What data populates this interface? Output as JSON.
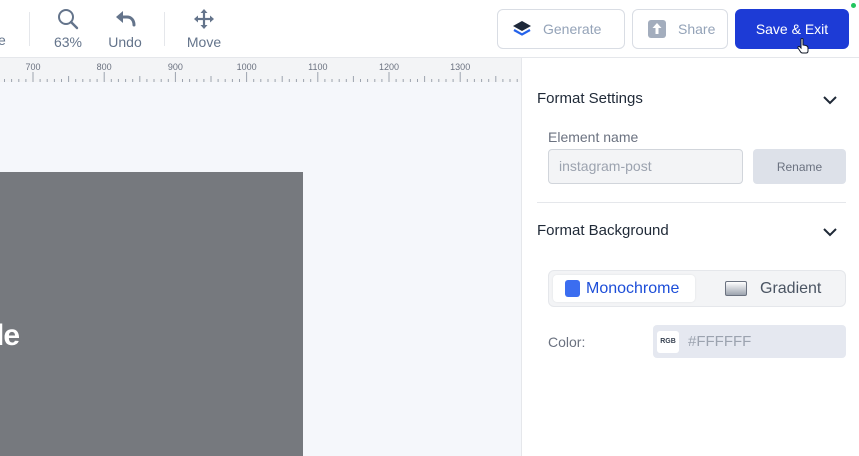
{
  "toolbar": {
    "cut_label": "e",
    "zoom_label": "63%",
    "undo_label": "Undo",
    "move_label": "Move",
    "generate_label": "Generate",
    "share_label": "Share",
    "save_exit_label": "Save & Exit"
  },
  "ruler": {
    "ticks": [
      "700",
      "800",
      "900",
      "1000",
      "1100",
      "1200",
      "1300"
    ]
  },
  "canvas": {
    "artboard_text": "le",
    "artboard_color": "#76797e"
  },
  "panel": {
    "format_settings_title": "Format Settings",
    "element_name_label": "Element name",
    "element_name_value": "instagram-post",
    "rename_label": "Rename",
    "format_background_title": "Format Background",
    "bg_modes": {
      "monochrome": "Monochrome",
      "gradient": "Gradient",
      "selected": "Monochrome"
    },
    "color_label": "Color:",
    "rgb_chip": "RGB",
    "color_value": "#FFFFFF"
  },
  "colors": {
    "accent": "#1d3bd6",
    "monochrome_swatch": "#3b6df0",
    "status_online": "#22c55e"
  },
  "icons": [
    "search-icon",
    "undo-icon",
    "move-icon",
    "layers-icon",
    "upload-icon",
    "chevron-down-icon",
    "pointer-cursor-icon"
  ]
}
